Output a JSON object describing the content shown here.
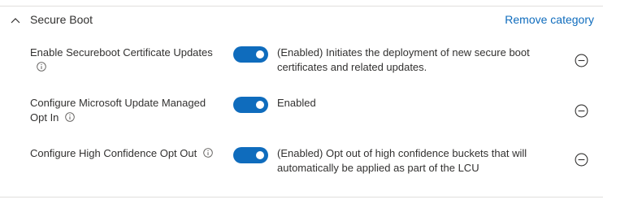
{
  "category": {
    "title": "Secure Boot",
    "remove_label": "Remove category",
    "chevron_icon": "chevron-up-icon"
  },
  "settings": [
    {
      "label": "Enable Secureboot Certificate Updates",
      "value": "(Enabled) Initiates the deployment of new secure boot certificates and related updates.",
      "enabled": true
    },
    {
      "label": "Configure Microsoft Update Managed Opt In",
      "value": "Enabled",
      "enabled": true
    },
    {
      "label": "Configure High Confidence Opt Out",
      "value": "(Enabled) Opt out of high confidence buckets that will automatically be applied as part of the LCU",
      "enabled": true
    }
  ],
  "colors": {
    "accent": "#0f6cbd",
    "text": "#323130",
    "divider": "#e1dfdd"
  },
  "icons": {
    "info": "info-icon",
    "remove": "remove-setting-icon",
    "collapse": "chevron-up-icon"
  }
}
